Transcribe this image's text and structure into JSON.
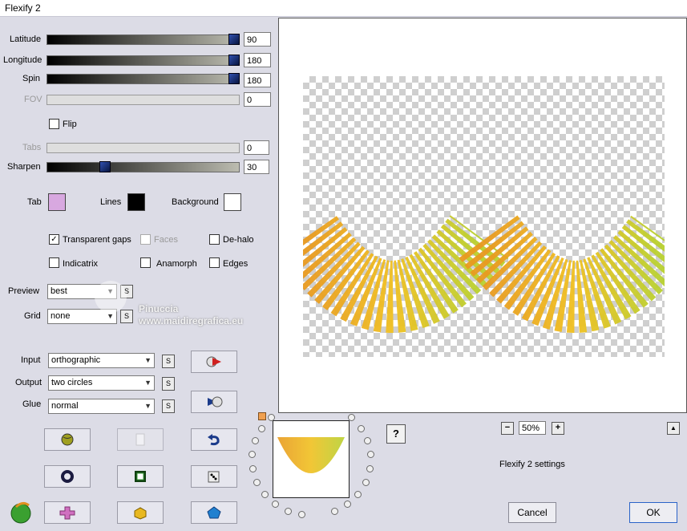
{
  "window": {
    "title": "Flexify 2"
  },
  "sliders": {
    "latitude": {
      "label": "Latitude",
      "value": "90"
    },
    "longitude": {
      "label": "Longitude",
      "value": "180"
    },
    "spin": {
      "label": "Spin",
      "value": "180"
    },
    "fov": {
      "label": "FOV",
      "value": "0"
    },
    "tabs": {
      "label": "Tabs",
      "value": "0"
    },
    "sharpen": {
      "label": "Sharpen",
      "value": "30"
    }
  },
  "flip": {
    "label": "Flip",
    "checked": false
  },
  "colors": {
    "tab": {
      "label": "Tab",
      "color": "#d8a8e0"
    },
    "lines": {
      "label": "Lines",
      "color": "#000000"
    },
    "background": {
      "label": "Background",
      "color": "#ffffff"
    }
  },
  "options": {
    "transparent_gaps": {
      "label": "Transparent gaps",
      "checked": true
    },
    "faces": {
      "label": "Faces",
      "checked": false
    },
    "de_halo": {
      "label": "De-halo",
      "checked": false
    },
    "indicatrix": {
      "label": "Indicatrix",
      "checked": false
    },
    "anamorph": {
      "label": "Anamorph",
      "checked": false
    },
    "edges": {
      "label": "Edges",
      "checked": false
    }
  },
  "preview_select": {
    "label": "Preview",
    "value": "best",
    "s": "S"
  },
  "grid_select": {
    "label": "Grid",
    "value": "none",
    "s": "S"
  },
  "input_select": {
    "label": "Input",
    "value": "orthographic",
    "s": "S"
  },
  "output_select": {
    "label": "Output",
    "value": "two circles",
    "s": "S"
  },
  "glue_select": {
    "label": "Glue",
    "value": "normal",
    "s": "S"
  },
  "watermark": {
    "name": "Pinuccia",
    "url": "www.maidiregrafica.eu"
  },
  "zoom": {
    "value": "50%",
    "minus": "−",
    "plus": "+"
  },
  "help": {
    "label": "?"
  },
  "collapse": {
    "label": "▲"
  },
  "settings_name": "Flexify 2 settings",
  "buttons": {
    "cancel": "Cancel",
    "ok": "OK"
  },
  "accent_colors": {
    "yellow": "#f0c020",
    "green": "#b8d030",
    "orange": "#e89a20"
  }
}
